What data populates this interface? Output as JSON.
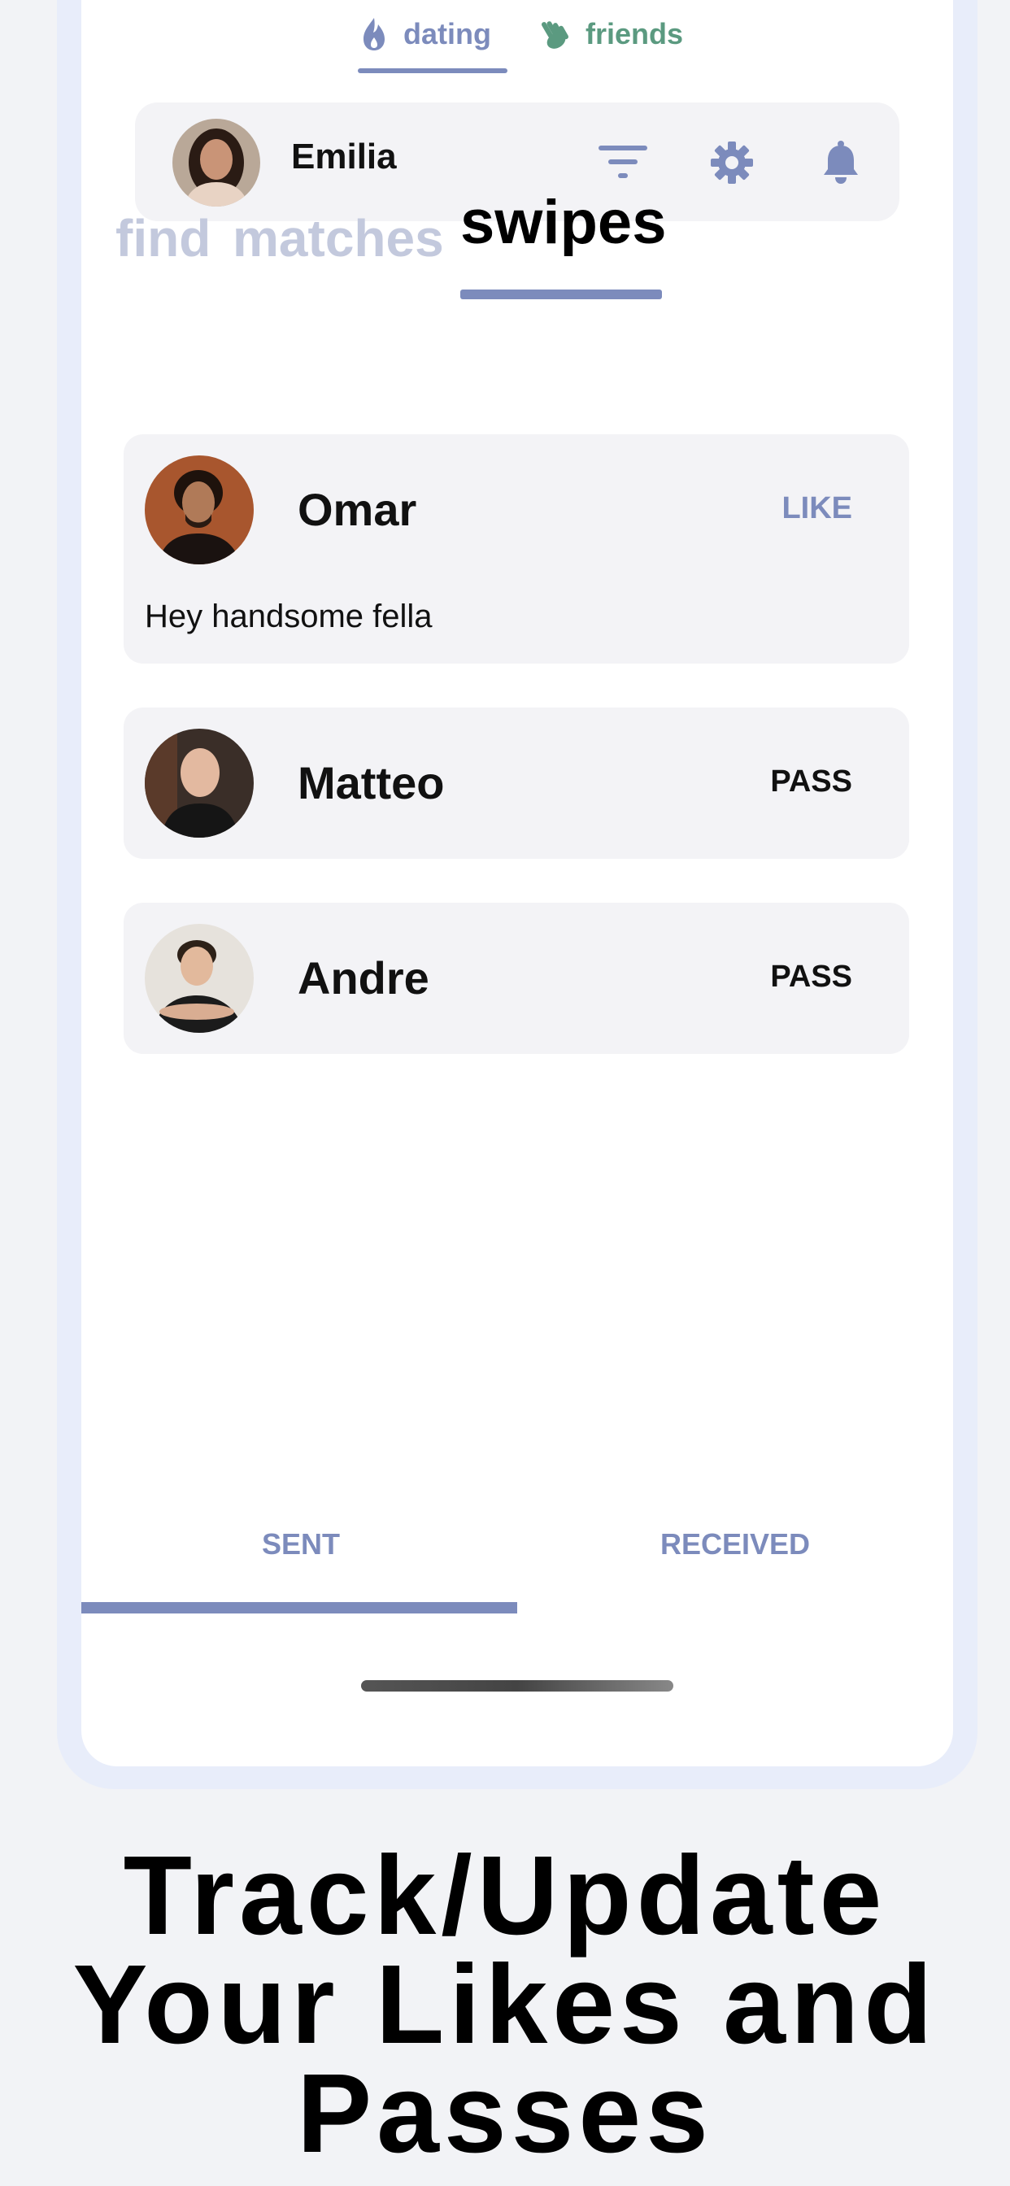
{
  "modes": [
    {
      "label": "dating",
      "icon": "flame-icon",
      "color": "#7c8bbc",
      "active": true
    },
    {
      "label": "friends",
      "icon": "wave-hand-icon",
      "color": "#5b9a80",
      "active": false
    }
  ],
  "profile": {
    "name": "Emilia"
  },
  "toolbar_icons": [
    "filter-icon",
    "gear-icon",
    "bell-icon"
  ],
  "tabs": {
    "find": "find",
    "matches": "matches",
    "swipes": "swipes",
    "active": "swipes"
  },
  "swipes": [
    {
      "name": "Omar",
      "status": "LIKE",
      "message": "Hey handsome fella",
      "status_color": "#7c8bbc"
    },
    {
      "name": "Matteo",
      "status": "PASS",
      "message": "",
      "status_color": "#111111"
    },
    {
      "name": "Andre",
      "status": "PASS",
      "message": "",
      "status_color": "#111111"
    }
  ],
  "bottom_tabs": {
    "sent": "SENT",
    "received": "RECEIVED",
    "active": "SENT"
  },
  "headline": {
    "line1": "Track/Update",
    "line2": "Your Likes and",
    "line3": "Passes"
  },
  "colors": {
    "accent": "#7c8bbc",
    "friends": "#5b9a80",
    "card_bg": "#f3f3f6",
    "frame": "#e8edfa"
  }
}
